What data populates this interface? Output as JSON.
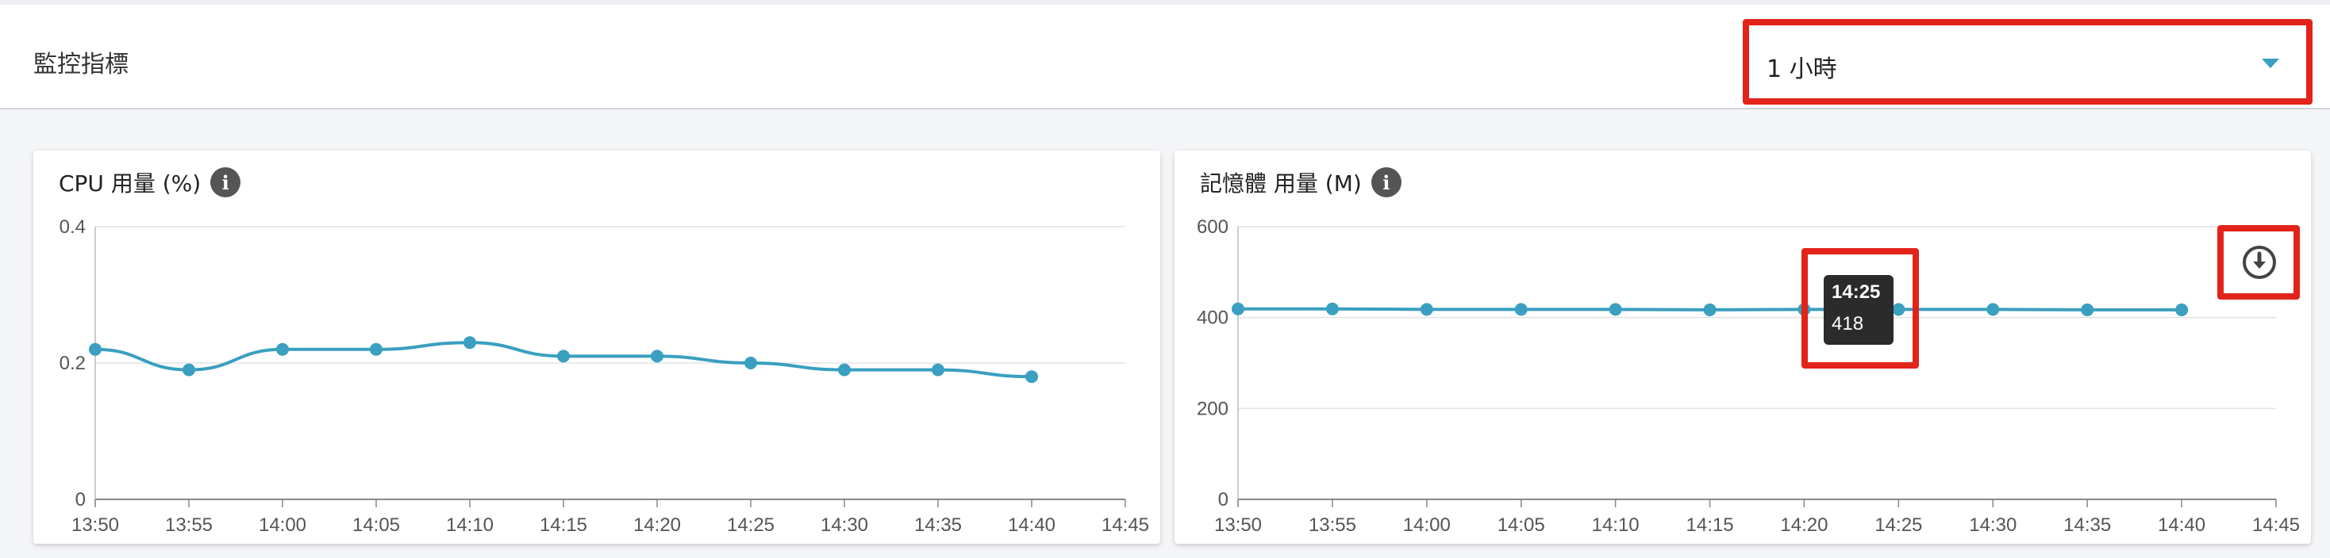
{
  "header": {
    "title": "監控指標",
    "time_range": {
      "selected": "1 小時"
    }
  },
  "colors": {
    "accent": "#3a9fc0",
    "highlight": "#e2231a"
  },
  "chart_data": [
    {
      "type": "line",
      "title": "CPU 用量 (%)",
      "x": [
        "13:50",
        "13:55",
        "14:00",
        "14:05",
        "14:10",
        "14:15",
        "14:20",
        "14:25",
        "14:30",
        "14:35",
        "14:40"
      ],
      "xticks": [
        "13:50",
        "13:55",
        "14:00",
        "14:05",
        "14:10",
        "14:15",
        "14:20",
        "14:25",
        "14:30",
        "14:35",
        "14:40",
        "14:45"
      ],
      "values": [
        0.22,
        0.19,
        0.22,
        0.22,
        0.23,
        0.21,
        0.21,
        0.2,
        0.19,
        0.19,
        0.18
      ],
      "yticks": [
        "0",
        "0.2",
        "0.4"
      ],
      "ylim": [
        0,
        0.4
      ],
      "grid": true
    },
    {
      "type": "line",
      "title": "記憶體 用量 (M)",
      "x": [
        "13:50",
        "13:55",
        "14:00",
        "14:05",
        "14:10",
        "14:15",
        "14:20",
        "14:25",
        "14:30",
        "14:35",
        "14:40"
      ],
      "xticks": [
        "13:50",
        "13:55",
        "14:00",
        "14:05",
        "14:10",
        "14:15",
        "14:20",
        "14:25",
        "14:30",
        "14:35",
        "14:40",
        "14:45"
      ],
      "values": [
        419,
        419,
        418,
        418,
        418,
        417,
        418,
        418,
        418,
        417,
        417
      ],
      "yticks": [
        "0",
        "200",
        "400",
        "600"
      ],
      "ylim": [
        0,
        600
      ],
      "grid": true,
      "tooltip": {
        "time": "14:25",
        "value": "418"
      }
    }
  ]
}
